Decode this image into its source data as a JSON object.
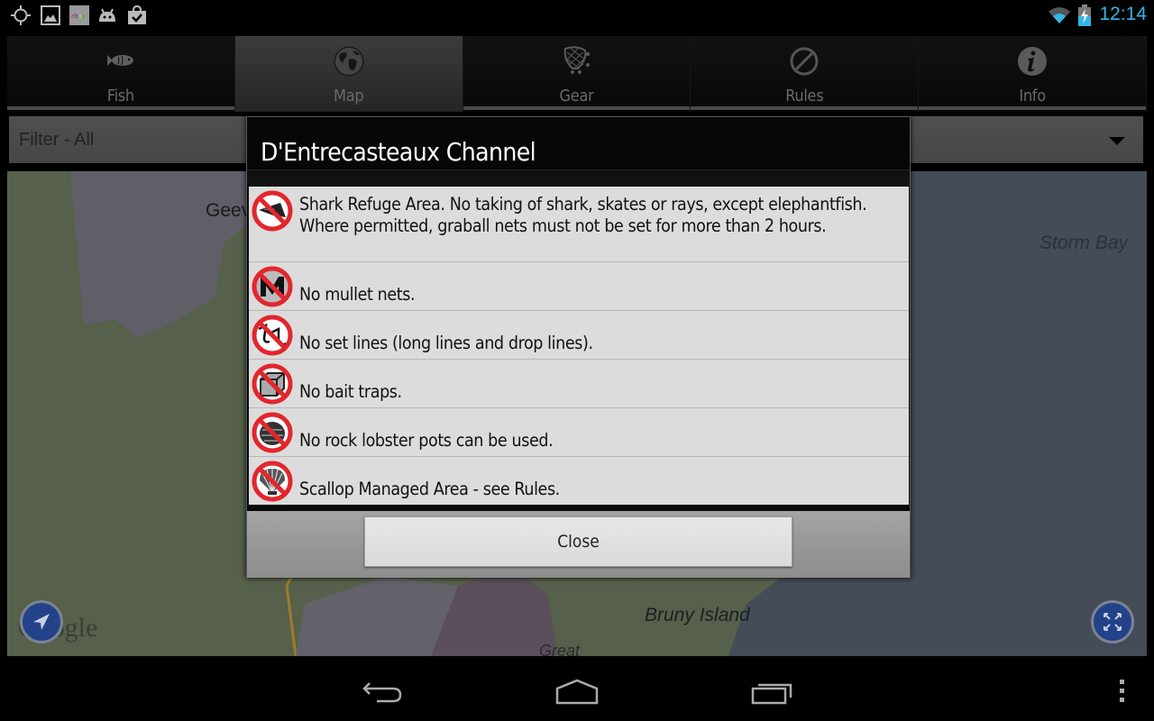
{
  "status_bar": {
    "left_icons": [
      "gps-icon",
      "gallery-icon",
      "ebay-icon",
      "android-icon",
      "shopping-bag-check-icon"
    ],
    "right_icons": [
      "wifi-icon",
      "battery-charging-icon"
    ],
    "time": "12:14",
    "accent_color": "#33b5e5"
  },
  "tabs": [
    {
      "label": "Fish",
      "icon": "fish-icon",
      "active": false
    },
    {
      "label": "Map",
      "icon": "globe-icon",
      "active": true
    },
    {
      "label": "Gear",
      "icon": "net-icon",
      "active": false
    },
    {
      "label": "Rules",
      "icon": "prohibited-icon",
      "active": false
    },
    {
      "label": "Info",
      "icon": "info-icon",
      "active": false
    }
  ],
  "filter": {
    "selected": "Filter - All"
  },
  "map": {
    "labels": {
      "geeveston": "Geev",
      "storm_bay": "Storm Bay",
      "bruny_island": "Bruny Island",
      "great": "Great"
    },
    "attribution": "Google",
    "buttons": {
      "my_location": "my-location-icon",
      "fullscreen": "fullscreen-icon"
    }
  },
  "dialog": {
    "title": "D'Entrecasteaux Channel",
    "rules": [
      {
        "icon": "no-shark-icon",
        "text": "Shark Refuge Area.  No taking of shark, skates or rays, except elephantfish. Where permitted, graball nets must not be set for more than 2 hours."
      },
      {
        "icon": "no-mullet-net-icon",
        "text": "No mullet nets."
      },
      {
        "icon": "no-set-lines-icon",
        "text": "No set lines (long lines and drop lines)."
      },
      {
        "icon": "no-bait-trap-icon",
        "text": "No bait traps."
      },
      {
        "icon": "no-lobster-pot-icon",
        "text": "No rock lobster pots can be used."
      },
      {
        "icon": "scallop-restricted-icon",
        "text": "Scallop Managed  Area - see Rules."
      }
    ],
    "close_label": "Close"
  },
  "nav_bar": {
    "buttons": [
      "back-icon",
      "home-icon",
      "recent-apps-icon",
      "overflow-menu-icon"
    ]
  }
}
